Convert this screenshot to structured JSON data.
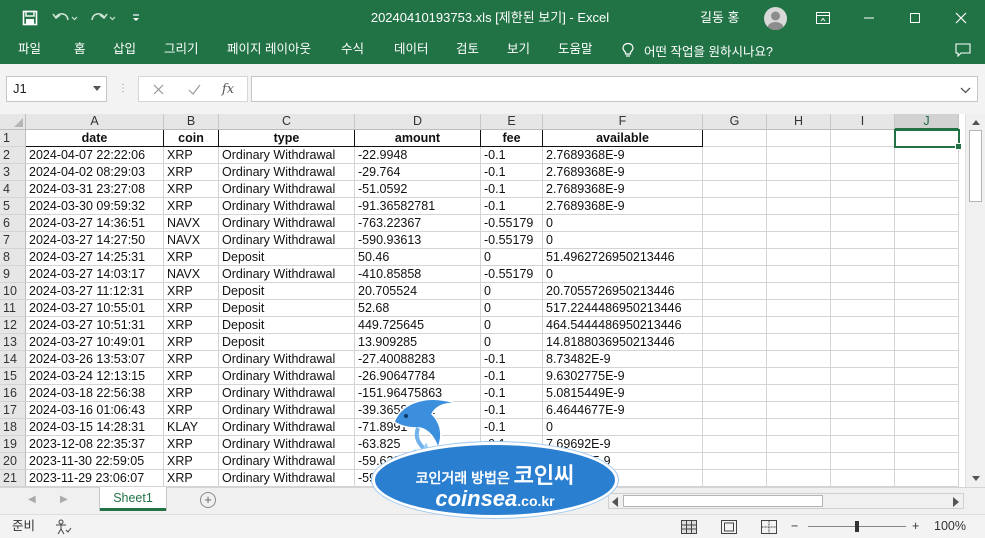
{
  "window": {
    "title": "20240410193753.xls  [제한된 보기]  -  Excel",
    "user": "길동 홍"
  },
  "ribbon": {
    "tabs": [
      "파일",
      "홈",
      "삽입",
      "그리기",
      "페이지 레이아웃",
      "수식",
      "데이터",
      "검토",
      "보기",
      "도움말"
    ],
    "tell_me": "어떤 작업을 원하시나요?"
  },
  "formula_bar": {
    "name_box": "J1",
    "fx": "fx",
    "formula": ""
  },
  "columns": [
    "A",
    "B",
    "C",
    "D",
    "E",
    "F",
    "G",
    "H",
    "I",
    "J"
  ],
  "selected_column": "J",
  "headers": [
    "date",
    "coin",
    "type",
    "amount",
    "fee",
    "available"
  ],
  "rows": [
    {
      "n": "2",
      "cells": [
        "2024-04-07 22:22:06",
        "XRP",
        "Ordinary Withdrawal",
        "-22.9948",
        "-0.1",
        "2.7689368E-9"
      ]
    },
    {
      "n": "3",
      "cells": [
        "2024-04-02 08:29:03",
        "XRP",
        "Ordinary Withdrawal",
        "-29.764",
        "-0.1",
        "2.7689368E-9"
      ]
    },
    {
      "n": "4",
      "cells": [
        "2024-03-31 23:27:08",
        "XRP",
        "Ordinary Withdrawal",
        "-51.0592",
        "-0.1",
        "2.7689368E-9"
      ]
    },
    {
      "n": "5",
      "cells": [
        "2024-03-30 09:59:32",
        "XRP",
        "Ordinary Withdrawal",
        "-91.36582781",
        "-0.1",
        "2.7689368E-9"
      ]
    },
    {
      "n": "6",
      "cells": [
        "2024-03-27 14:36:51",
        "NAVX",
        "Ordinary Withdrawal",
        "-763.22367",
        "-0.55179",
        "0"
      ]
    },
    {
      "n": "7",
      "cells": [
        "2024-03-27 14:27:50",
        "NAVX",
        "Ordinary Withdrawal",
        "-590.93613",
        "-0.55179",
        "0"
      ]
    },
    {
      "n": "8",
      "cells": [
        "2024-03-27 14:25:31",
        "XRP",
        "Deposit",
        "50.46",
        "0",
        "51.4962726950213446"
      ]
    },
    {
      "n": "9",
      "cells": [
        "2024-03-27 14:03:17",
        "NAVX",
        "Ordinary Withdrawal",
        "-410.85858",
        "-0.55179",
        "0"
      ]
    },
    {
      "n": "10",
      "cells": [
        "2024-03-27 11:12:31",
        "XRP",
        "Deposit",
        "20.705524",
        "0",
        "20.7055726950213446"
      ]
    },
    {
      "n": "11",
      "cells": [
        "2024-03-27 10:55:01",
        "XRP",
        "Deposit",
        "52.68",
        "0",
        "517.2244486950213446"
      ]
    },
    {
      "n": "12",
      "cells": [
        "2024-03-27 10:51:31",
        "XRP",
        "Deposit",
        "449.725645",
        "0",
        "464.5444486950213446"
      ]
    },
    {
      "n": "13",
      "cells": [
        "2024-03-27 10:49:01",
        "XRP",
        "Deposit",
        "13.909285",
        "0",
        "14.8188036950213446"
      ]
    },
    {
      "n": "14",
      "cells": [
        "2024-03-26 13:53:07",
        "XRP",
        "Ordinary Withdrawal",
        "-27.40088283",
        "-0.1",
        "8.73482E-9"
      ]
    },
    {
      "n": "15",
      "cells": [
        "2024-03-24 12:13:15",
        "XRP",
        "Ordinary Withdrawal",
        "-26.90647784",
        "-0.1",
        "9.6302775E-9"
      ]
    },
    {
      "n": "16",
      "cells": [
        "2024-03-18 22:56:38",
        "XRP",
        "Ordinary Withdrawal",
        "-151.96475863",
        "-0.1",
        "5.0815449E-9"
      ]
    },
    {
      "n": "17",
      "cells": [
        "2024-03-16 01:06:43",
        "XRP",
        "Ordinary Withdrawal",
        "-39.36585832",
        "-0.1",
        "6.4644677E-9"
      ]
    },
    {
      "n": "18",
      "cells": [
        "2024-03-15 14:28:31",
        "KLAY",
        "Ordinary Withdrawal",
        "-71.8991",
        "-0.1",
        "0"
      ]
    },
    {
      "n": "19",
      "cells": [
        "2023-12-08 22:35:37",
        "XRP",
        "Ordinary Withdrawal",
        "-63.825",
        "-0.1",
        "7.69692E-9"
      ]
    },
    {
      "n": "20",
      "cells": [
        "2023-11-30 22:59:05",
        "XRP",
        "Ordinary Withdrawal",
        "-59.638",
        "-0.1",
        "7.69692E-9"
      ]
    },
    {
      "n": "21",
      "cells": [
        "2023-11-29 23:06:07",
        "XRP",
        "Ordinary Withdrawal",
        "-59.6",
        "-0.1",
        "7.69692E-9"
      ]
    }
  ],
  "sheet_tabs": [
    "Sheet1"
  ],
  "status": {
    "mode": "준비",
    "zoom": "100%"
  },
  "watermark": {
    "line1": "코인거래 방법은",
    "line1_brand": "코인씨",
    "line2": "coinsea",
    "line2_suffix": ".co.kr"
  },
  "colors": {
    "excel_green": "#217346",
    "watermark_blue": "#2b7fd0"
  }
}
